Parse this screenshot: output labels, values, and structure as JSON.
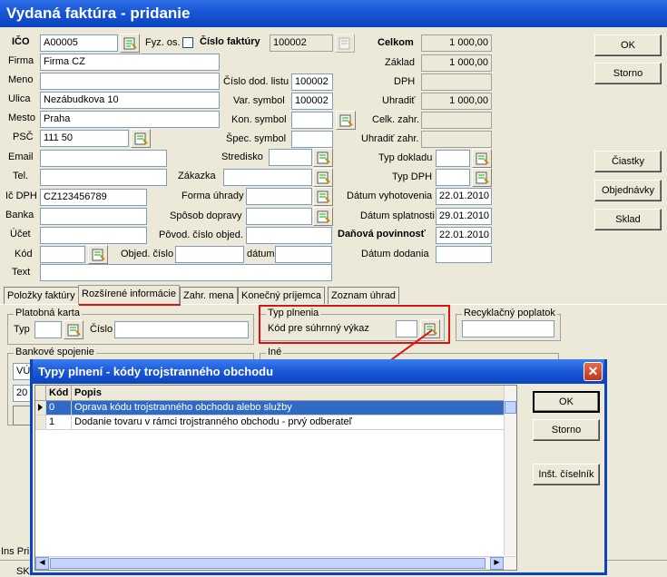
{
  "window": {
    "title": "Vydaná faktúra   -   pridanie"
  },
  "customer": {
    "ico_label": "IČO",
    "ico": "A00005",
    "fyz_os_label": "Fyz. os.",
    "firma_label": "Firma",
    "firma": "Firma CZ",
    "meno_label": "Meno",
    "meno": "",
    "ulica_label": "Ulica",
    "ulica": "Nezábudkova 10",
    "mesto_label": "Mesto",
    "mesto": "Praha",
    "psc_label": "PSČ",
    "psc": "111 50",
    "email_label": "Email",
    "tel_label": "Tel.",
    "icdph_label": "Ič DPH",
    "icdph": "CZ123456789",
    "banka_label": "Banka",
    "ucet_label": "Účet",
    "kod_label": "Kód",
    "text_label": "Text"
  },
  "invoice": {
    "cislo_label": "Číslo faktúry",
    "cislo": "100002",
    "dod_list_label": "Číslo dod. listu",
    "dod_list": "100002",
    "var_symbol_label": "Var. symbol",
    "var_symbol": "100002",
    "kon_symbol_label": "Kon. symbol",
    "spec_symbol_label": "Špec. symbol",
    "stredisko_label": "Stredisko",
    "zakazka_label": "Zákazka",
    "forma_uhrady_label": "Forma úhrady",
    "sposob_dopravy_label": "Spôsob dopravy",
    "povod_cislo_label": "Pôvod. číslo objed.",
    "obj_cislo_label": "Objed. číslo",
    "datum_label": "dátum"
  },
  "totals": {
    "celkom_label": "Celkom",
    "celkom": "1 000,00",
    "zaklad_label": "Základ",
    "zaklad": "1 000,00",
    "dph_label": "DPH",
    "uhradit_label": "Uhradiť",
    "uhradit": "1 000,00",
    "celk_zahr_label": "Celk. zahr.",
    "uhradit_zahr_label": "Uhradiť zahr."
  },
  "dates": {
    "typ_dokladu_label": "Typ dokladu",
    "typ_dph_label": "Typ DPH",
    "vyhotovenia_label": "Dátum vyhotovenia",
    "vyhotovenia": "22.01.2010",
    "splatnosti_label": "Dátum splatnosti",
    "splatnosti": "29.01.2010",
    "danova_label": "Daňová povinnosť",
    "danova": "22.01.2010",
    "dodania_label": "Dátum dodania"
  },
  "right_buttons": {
    "ok": "OK",
    "storno": "Storno",
    "ciastky": "Čiastky",
    "objednavky": "Objednávky",
    "sklad": "Sklad"
  },
  "tabs": [
    "Položky faktúry",
    "Rozšírené informácie",
    "Zahr. mena",
    "Konečný príjemca",
    "Zoznam úhrad"
  ],
  "ext": {
    "platobna_karta": "Platobná karta",
    "typ_label": "Typ",
    "cislo_label": "Číslo",
    "typ_plnenia": "Typ plnenia",
    "kod_suhrnny_label": "Kód pre súhrnný výkaz",
    "recyklacny": "Recyklačný poplatok",
    "bankove_spojenie": "Bankové spojenie",
    "ine": "Iné",
    "bank_partial": "VÚ",
    "bank_partial2": "20"
  },
  "status": {
    "left": "Ins Pri",
    "bottom": "SK"
  },
  "dialog": {
    "title": "Typy plnení - kódy trojstranného obchodu",
    "columns": [
      "Kód",
      "Popis"
    ],
    "rows": [
      {
        "kod": "0",
        "popis": "Oprava kódu trojstranného obchodu alebo služby"
      },
      {
        "kod": "1",
        "popis": "Dodanie tovaru v rámci trojstranného obchodu - prvý odberateľ"
      }
    ],
    "ok": "OK",
    "storno": "Storno",
    "inst_ciselnik": "Inšt. číselník"
  },
  "colors": {
    "titlebar": "#0a44c0",
    "selection": "#316ac5",
    "annotation": "#e01010"
  }
}
